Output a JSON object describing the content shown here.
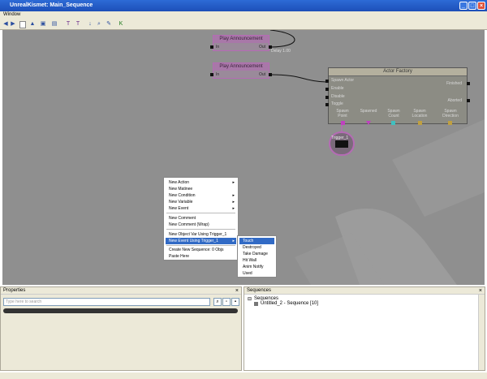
{
  "window": {
    "title": "UnrealKismet: Main_Sequence",
    "menu": "Window"
  },
  "canvas_nodes": {
    "announce1": {
      "title": "Play Announcement",
      "in": "In",
      "out": "Out"
    },
    "announce2": {
      "title": "Play Announcement",
      "in": "In",
      "out": "Out"
    },
    "delay": "Delay 1.00",
    "factory": {
      "title": "Actor Factory",
      "inputs": [
        "Spawn Actor",
        "Enable",
        "Disable",
        "Toggle"
      ],
      "outputs": [
        "Finished",
        "Aborted"
      ],
      "vars": [
        "Spawn Point",
        "Spawned",
        "Spawn Count",
        "Spawn Location",
        "Spawn Direction"
      ]
    },
    "trigger": "Trigger_1"
  },
  "context_menu": {
    "items": [
      {
        "label": "New Action",
        "submenu": true
      },
      {
        "label": "New Matinee",
        "submenu": false
      },
      {
        "label": "New Condition",
        "submenu": true
      },
      {
        "label": "New Variable",
        "submenu": true
      },
      {
        "label": "New Event",
        "submenu": true
      },
      {
        "label": "New Comment",
        "submenu": false
      },
      {
        "label": "New Comment (Wrap)",
        "submenu": false
      },
      {
        "label": "New Object Var Using Trigger_1",
        "submenu": false
      },
      {
        "label": "New Event Using Trigger_1",
        "submenu": true,
        "selected": true
      },
      {
        "label": "Create New Sequence: 0 Objs",
        "submenu": false
      },
      {
        "label": "Paste Here",
        "submenu": false
      }
    ],
    "submenu": [
      "Touch",
      "Destroyed",
      "Take Damage",
      "Hit Wall",
      "Anim Notify",
      "Used"
    ],
    "submenu_selected": "Touch"
  },
  "properties": {
    "title": "Properties",
    "search_placeholder": "Type here to search"
  },
  "sequences": {
    "title": "Sequences",
    "root": "Sequences",
    "child": "Untitled_2 - Sequence [10]"
  },
  "colors": {
    "accent": "#316ac5",
    "node_border": "#b56bb5",
    "canvas": "#8f8f8f"
  }
}
